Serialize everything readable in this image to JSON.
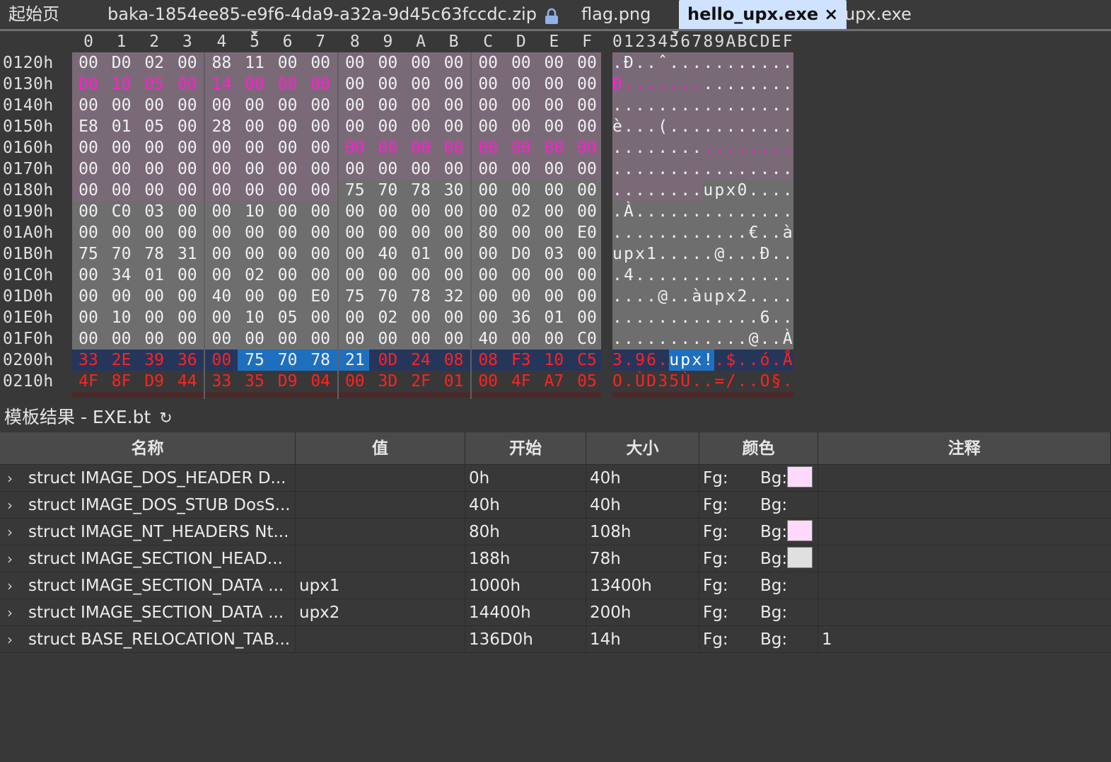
{
  "tabs": [
    {
      "label": "起始页"
    },
    {
      "label": "baka-1854ee85-e9f6-4da9-a32a-9d45c63fccdc.zip",
      "icon": "lock-icon"
    },
    {
      "label": "flag.png"
    },
    {
      "label": "hello_upx.exe",
      "active": true,
      "close": "×"
    },
    {
      "label": "upx.exe"
    }
  ],
  "hex": {
    "columns": [
      "0",
      "1",
      "2",
      "3",
      "4",
      "5",
      "6",
      "7",
      "8",
      "9",
      "A",
      "B",
      "C",
      "D",
      "E",
      "F"
    ],
    "ascii_header": "0123456789ABCDEF",
    "rows": [
      {
        "addr": "0120h",
        "bytes": [
          "00",
          "D0",
          "02",
          "00",
          "88",
          "11",
          "00",
          "00",
          "00",
          "00",
          "00",
          "00",
          "00",
          "00",
          "00",
          "00"
        ],
        "ascii": ".Ð..ˆ..........."
      },
      {
        "addr": "0130h",
        "bytes": [
          "D0",
          "10",
          "05",
          "00",
          "14",
          "00",
          "00",
          "00",
          "00",
          "00",
          "00",
          "00",
          "00",
          "00",
          "00",
          "00"
        ],
        "ascii": "Ð..............."
      },
      {
        "addr": "0140h",
        "bytes": [
          "00",
          "00",
          "00",
          "00",
          "00",
          "00",
          "00",
          "00",
          "00",
          "00",
          "00",
          "00",
          "00",
          "00",
          "00",
          "00"
        ],
        "ascii": "................"
      },
      {
        "addr": "0150h",
        "bytes": [
          "E8",
          "01",
          "05",
          "00",
          "28",
          "00",
          "00",
          "00",
          "00",
          "00",
          "00",
          "00",
          "00",
          "00",
          "00",
          "00"
        ],
        "ascii": "è...(..........."
      },
      {
        "addr": "0160h",
        "bytes": [
          "00",
          "00",
          "00",
          "00",
          "00",
          "00",
          "00",
          "00",
          "00",
          "00",
          "00",
          "00",
          "00",
          "00",
          "00",
          "00"
        ],
        "ascii": "................"
      },
      {
        "addr": "0170h",
        "bytes": [
          "00",
          "00",
          "00",
          "00",
          "00",
          "00",
          "00",
          "00",
          "00",
          "00",
          "00",
          "00",
          "00",
          "00",
          "00",
          "00"
        ],
        "ascii": "................"
      },
      {
        "addr": "0180h",
        "bytes": [
          "00",
          "00",
          "00",
          "00",
          "00",
          "00",
          "00",
          "00",
          "75",
          "70",
          "78",
          "30",
          "00",
          "00",
          "00",
          "00"
        ],
        "ascii": "........upx0...."
      },
      {
        "addr": "0190h",
        "bytes": [
          "00",
          "C0",
          "03",
          "00",
          "00",
          "10",
          "00",
          "00",
          "00",
          "00",
          "00",
          "00",
          "00",
          "02",
          "00",
          "00"
        ],
        "ascii": ".À.............."
      },
      {
        "addr": "01A0h",
        "bytes": [
          "00",
          "00",
          "00",
          "00",
          "00",
          "00",
          "00",
          "00",
          "00",
          "00",
          "00",
          "00",
          "80",
          "00",
          "00",
          "E0"
        ],
        "ascii": "............€..à"
      },
      {
        "addr": "01B0h",
        "bytes": [
          "75",
          "70",
          "78",
          "31",
          "00",
          "00",
          "00",
          "00",
          "00",
          "40",
          "01",
          "00",
          "00",
          "D0",
          "03",
          "00"
        ],
        "ascii": "upx1.....@...Ð.."
      },
      {
        "addr": "01C0h",
        "bytes": [
          "00",
          "34",
          "01",
          "00",
          "00",
          "02",
          "00",
          "00",
          "00",
          "00",
          "00",
          "00",
          "00",
          "00",
          "00",
          "00"
        ],
        "ascii": ".4.............."
      },
      {
        "addr": "01D0h",
        "bytes": [
          "00",
          "00",
          "00",
          "00",
          "40",
          "00",
          "00",
          "E0",
          "75",
          "70",
          "78",
          "32",
          "00",
          "00",
          "00",
          "00"
        ],
        "ascii": "....@..àupx2...."
      },
      {
        "addr": "01E0h",
        "bytes": [
          "00",
          "10",
          "00",
          "00",
          "00",
          "10",
          "05",
          "00",
          "00",
          "02",
          "00",
          "00",
          "00",
          "36",
          "01",
          "00"
        ],
        "ascii": ".............6.."
      },
      {
        "addr": "01F0h",
        "bytes": [
          "00",
          "00",
          "00",
          "00",
          "00",
          "00",
          "00",
          "00",
          "00",
          "00",
          "00",
          "00",
          "40",
          "00",
          "00",
          "C0"
        ],
        "ascii": "............@..À"
      },
      {
        "addr": "0200h",
        "bytes": [
          "33",
          "2E",
          "39",
          "36",
          "00",
          "75",
          "70",
          "78",
          "21",
          "0D",
          "24",
          "08",
          "08",
          "F3",
          "10",
          "C5"
        ],
        "ascii": "3.96.upx!.$..ó.Å"
      },
      {
        "addr": "0210h",
        "bytes": [
          "4F",
          "8F",
          "D9",
          "44",
          "33",
          "35",
          "D9",
          "04",
          "00",
          "3D",
          "2F",
          "01",
          "00",
          "4F",
          "A7",
          "05"
        ],
        "ascii": "O.ÙD35Ù..=/..O§."
      }
    ]
  },
  "template": {
    "title": "模板结果 - EXE.bt",
    "refresh_icon": "refresh-icon",
    "headers": [
      "名称",
      "值",
      "开始",
      "大小",
      "颜色",
      "注释"
    ],
    "rows": [
      {
        "name": "struct IMAGE_DOS_HEADER D...",
        "value": "",
        "start": "0h",
        "size": "40h",
        "fg": "Fg:",
        "bg": "Bg:",
        "bg_color": "#ffd9f9",
        "comment": ""
      },
      {
        "name": "struct IMAGE_DOS_STUB DosS...",
        "value": "",
        "start": "40h",
        "size": "40h",
        "fg": "Fg:",
        "bg": "Bg:",
        "bg_color": "",
        "comment": ""
      },
      {
        "name": "struct IMAGE_NT_HEADERS Nt...",
        "value": "",
        "start": "80h",
        "size": "108h",
        "fg": "Fg:",
        "bg": "Bg:",
        "bg_color": "#ffd9f9",
        "comment": ""
      },
      {
        "name": "struct IMAGE_SECTION_HEAD...",
        "value": "",
        "start": "188h",
        "size": "78h",
        "fg": "Fg:",
        "bg": "Bg:",
        "bg_color": "#e0e0e0",
        "comment": ""
      },
      {
        "name": "struct IMAGE_SECTION_DATA ...",
        "value": "upx1",
        "start": "1000h",
        "size": "13400h",
        "fg": "Fg:",
        "bg": "Bg:",
        "bg_color": "",
        "comment": ""
      },
      {
        "name": "struct IMAGE_SECTION_DATA ...",
        "value": "upx2",
        "start": "14400h",
        "size": "200h",
        "fg": "Fg:",
        "bg": "Bg:",
        "bg_color": "",
        "comment": ""
      },
      {
        "name": "struct BASE_RELOCATION_TAB...",
        "value": "",
        "start": "136D0h",
        "size": "14h",
        "fg": "Fg:",
        "bg": "Bg:",
        "bg_color": "",
        "comment": "1"
      }
    ]
  },
  "colors": {
    "nt_header_bg": "#7a6a78",
    "section_header_bg": "#6e6e6e",
    "selection_bg": "#1f6fbf",
    "overlay_bg": "#26365a",
    "highlight_magenta": "#ff1fd0",
    "highlight_red": "#ff2222"
  }
}
